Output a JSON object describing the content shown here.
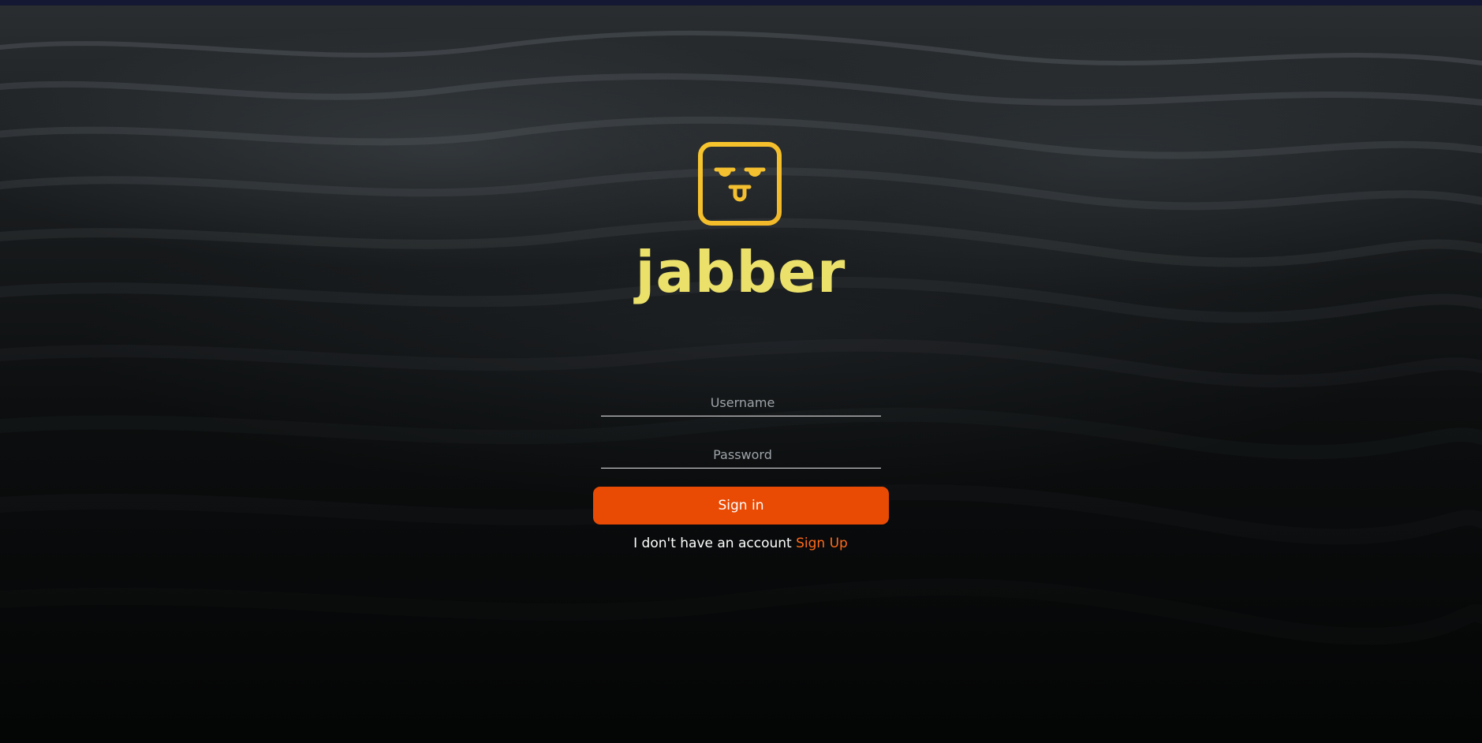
{
  "brand": {
    "name": "jabber",
    "logo_icon": "tongue-face-icon",
    "logo_color": "#f5c02f",
    "wordmark_color": "#ebe06a"
  },
  "login_form": {
    "username_placeholder": "Username",
    "password_placeholder": "Password",
    "submit_label": "Sign in",
    "submit_color": "#e94b05"
  },
  "signup_prompt": {
    "text": "I don't have an account",
    "link_label": "Sign Up",
    "link_color": "#ff6a1a"
  },
  "background": {
    "description_icon": "ocean-waves-image"
  }
}
